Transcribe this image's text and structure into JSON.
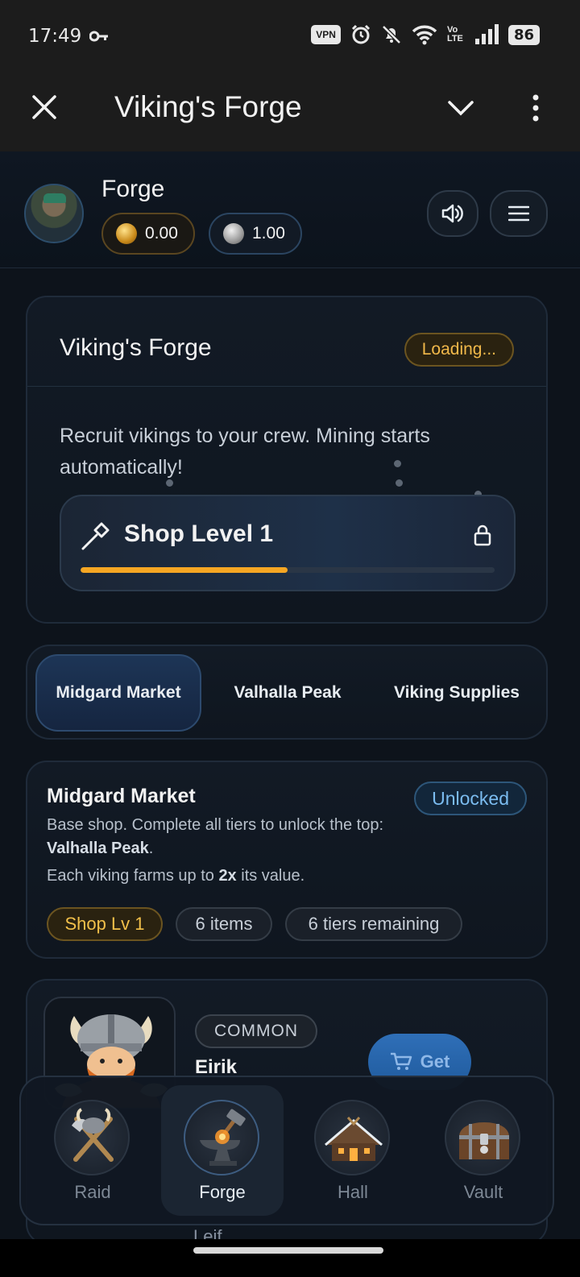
{
  "status_bar": {
    "time": "17:49",
    "vpn": "VPN",
    "volte": "Vo LTE",
    "battery": "86"
  },
  "app_bar": {
    "title": "Viking's Forge"
  },
  "header": {
    "name": "Forge",
    "gold_balance": "0.00",
    "silver_balance": "1.00"
  },
  "forge_card": {
    "title": "Viking's Forge",
    "status": "Loading...",
    "description": "Recruit vikings to your crew. Mining starts automatically!",
    "shop_level_label": "Shop Level 1",
    "shop_level_progress": 0.5
  },
  "tabs": [
    {
      "label": "Midgard Market",
      "active": true
    },
    {
      "label": "Valhalla Peak",
      "active": false
    },
    {
      "label": "Viking Supplies",
      "active": false
    }
  ],
  "market": {
    "title": "Midgard Market",
    "status": "Unlocked",
    "desc_prefix": "Base shop. Complete all tiers to unlock the top: ",
    "desc_bold": "Valhalla Peak",
    "desc_suffix": ".",
    "farm_prefix": "Each viking farms up to ",
    "farm_bold": "2x",
    "farm_suffix": " its value.",
    "chips": [
      "Shop Lv 1",
      "6 items",
      "6 tiers remaining"
    ]
  },
  "item": {
    "rarity": "COMMON",
    "name": "Eirik",
    "button": "Get"
  },
  "next_item_peek": "Leif",
  "nav": [
    {
      "label": "Raid",
      "active": false
    },
    {
      "label": "Forge",
      "active": true
    },
    {
      "label": "Hall",
      "active": false
    },
    {
      "label": "Vault",
      "active": false
    }
  ]
}
